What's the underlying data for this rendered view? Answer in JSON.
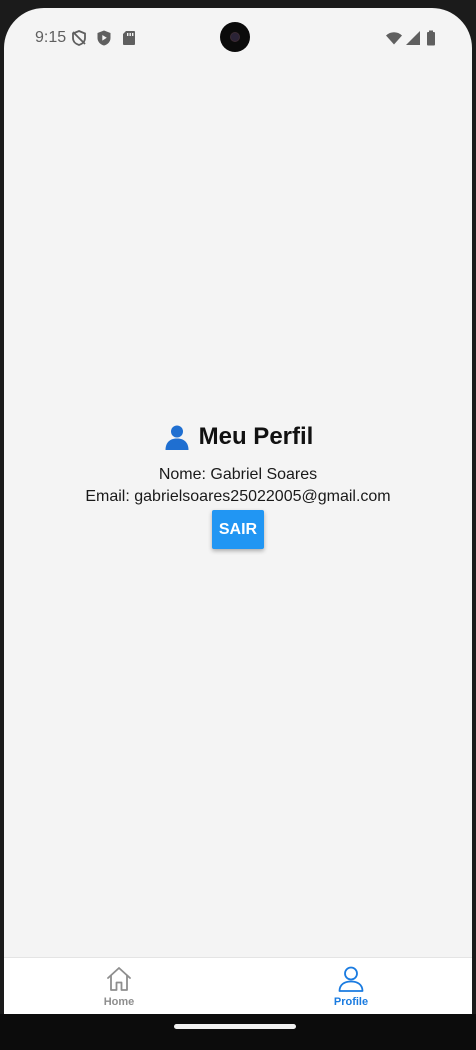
{
  "status_bar": {
    "time": "9:15",
    "icons": [
      "shield-off-icon",
      "play-protect-icon",
      "sd-card-icon",
      "wifi-icon",
      "signal-icon",
      "battery-icon"
    ]
  },
  "profile": {
    "title": "Meu Perfil",
    "title_icon": "person-icon",
    "name_line": "Nome: Gabriel Soares",
    "email_line": "Email: gabrielsoares25022005@gmail.com",
    "logout_label": "SAIR"
  },
  "tab_bar": {
    "tabs": [
      {
        "label": "Home",
        "icon": "home-icon",
        "active": false
      },
      {
        "label": "Profile",
        "icon": "user-icon",
        "active": true
      }
    ]
  },
  "colors": {
    "accent": "#2196f3",
    "active_tab": "#1a7be0",
    "inactive_tab": "#8e8e8e",
    "background": "#f4f4f4"
  }
}
